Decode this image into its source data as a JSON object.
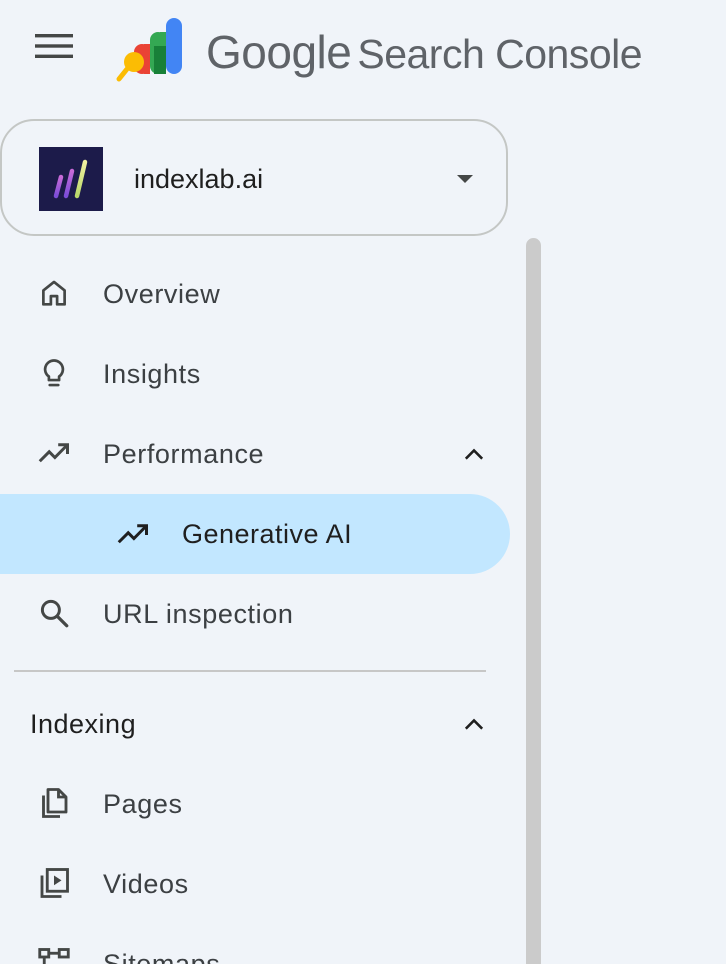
{
  "header": {
    "menu_icon": "hamburger-menu-icon",
    "logo_icon": "search-console-logo-icon",
    "title_brand": "Google",
    "title_product": "Search Console"
  },
  "property": {
    "name": "indexlab.ai",
    "logo_icon": "indexlab-logo-icon",
    "caret_icon": "arrow-drop-down-icon"
  },
  "nav": {
    "items": [
      {
        "label": "Overview",
        "icon": "home-icon"
      },
      {
        "label": "Insights",
        "icon": "lightbulb-icon"
      },
      {
        "label": "Performance",
        "icon": "trending-up-icon",
        "expanded": true
      },
      {
        "label": "Generative AI",
        "icon": "trending-up-icon",
        "active": true
      },
      {
        "label": "URL inspection",
        "icon": "search-icon"
      }
    ],
    "sections": [
      {
        "label": "Indexing",
        "expanded": true,
        "items": [
          {
            "label": "Pages",
            "icon": "pages-icon"
          },
          {
            "label": "Videos",
            "icon": "video-library-icon"
          },
          {
            "label": "Sitemaps",
            "icon": "sitemap-icon"
          }
        ]
      }
    ]
  },
  "colors": {
    "background": "#f0f4f9",
    "active_bg": "#c2e7ff",
    "text": "#1f1f1f",
    "icon": "#444746",
    "google_blue": "#4285f4",
    "google_green": "#34a853",
    "google_red": "#ea4335",
    "google_yellow": "#fbbc04"
  }
}
